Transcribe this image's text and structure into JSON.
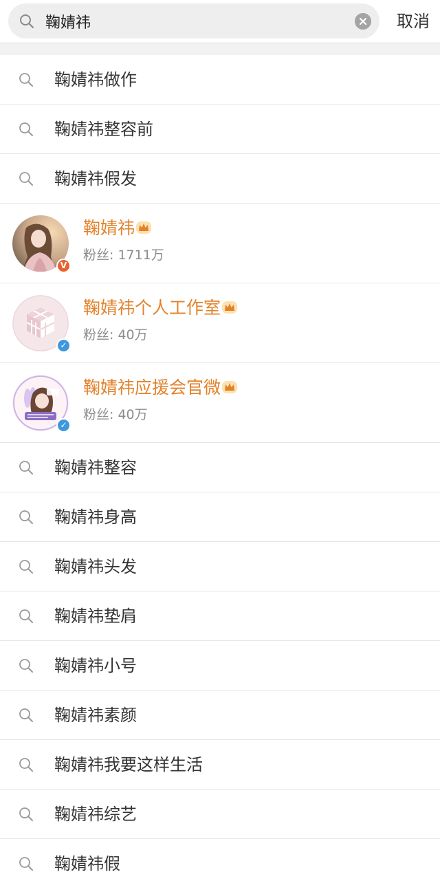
{
  "search": {
    "query": "鞠婧祎",
    "cancel_label": "取消"
  },
  "colors": {
    "name_orange": "#e3822b",
    "verified_orange": "#e8612c",
    "verified_blue": "#3f97dc"
  },
  "suggestions_top": [
    {
      "label": "鞠婧祎做作"
    },
    {
      "label": "鞠婧祎整容前"
    },
    {
      "label": "鞠婧祎假发"
    }
  ],
  "users": [
    {
      "name": "鞠婧祎",
      "fans": "粉丝: 1711万",
      "badge": "V",
      "badge_color": "orange",
      "avatar": "photo-avatar"
    },
    {
      "name": "鞠婧祎个人工作室",
      "fans": "粉丝: 40万",
      "badge": "✓",
      "badge_color": "blue",
      "avatar": "cube-logo-avatar"
    },
    {
      "name": "鞠婧祎应援会官微",
      "fans": "粉丝: 40万",
      "badge": "✓",
      "badge_color": "blue",
      "avatar": "fan-club-avatar"
    }
  ],
  "suggestions_bottom": [
    {
      "label": "鞠婧祎整容"
    },
    {
      "label": "鞠婧祎身高"
    },
    {
      "label": "鞠婧祎头发"
    },
    {
      "label": "鞠婧祎垫肩"
    },
    {
      "label": "鞠婧祎小号"
    },
    {
      "label": "鞠婧祎素颜"
    },
    {
      "label": "鞠婧祎我要这样生活"
    },
    {
      "label": "鞠婧祎综艺"
    },
    {
      "label": "鞠婧祎假"
    }
  ],
  "icons": {
    "search": "search-icon",
    "clear": "clear-icon",
    "crown": "crown-icon"
  }
}
